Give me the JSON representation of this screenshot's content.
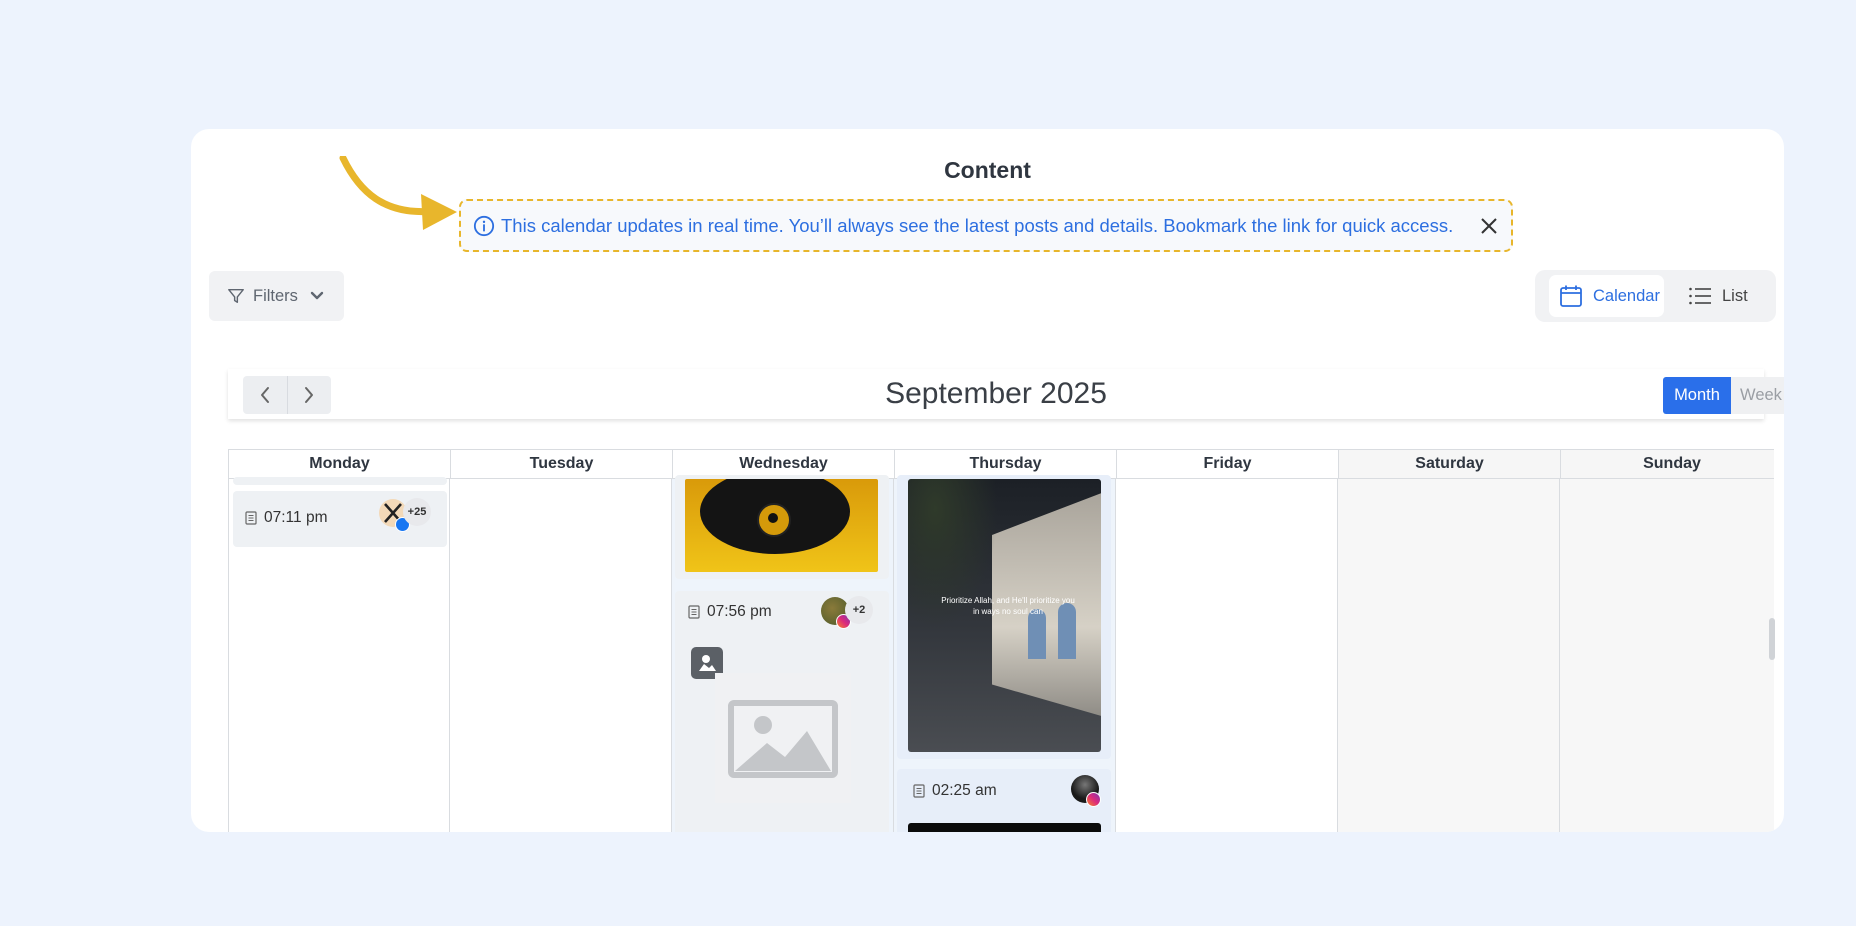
{
  "page": {
    "title": "Content"
  },
  "banner": {
    "text": "This calendar updates in real time. You’ll always see the latest posts and details. Bookmark the link for quick access."
  },
  "toolbar": {
    "filters_label": "Filters"
  },
  "view_toggle": {
    "calendar_label": "Calendar",
    "list_label": "List",
    "active": "Calendar"
  },
  "calendar": {
    "month_title": "September 2025",
    "mode_month": "Month",
    "mode_week": "Week",
    "active_mode": "Month",
    "days": [
      "Monday",
      "Tuesday",
      "Wednesday",
      "Thursday",
      "Friday",
      "Saturday",
      "Sunday"
    ],
    "events": {
      "monday": {
        "time": "07:11 pm",
        "more": "+25",
        "platform": "facebook"
      },
      "wednesday": {
        "time": "07:56 pm",
        "more": "+2",
        "platform": "instagram"
      },
      "thursday": {
        "time": "02:25 am",
        "platform": "instagram"
      }
    },
    "thursday_image_caption": "Prioritize Allah, and He'll prioritize you in ways no soul can"
  },
  "colors": {
    "accent": "#2a6fea",
    "banner_border": "#e8b62c",
    "arrow": "#e8b62c",
    "background": "#edf3fd"
  }
}
